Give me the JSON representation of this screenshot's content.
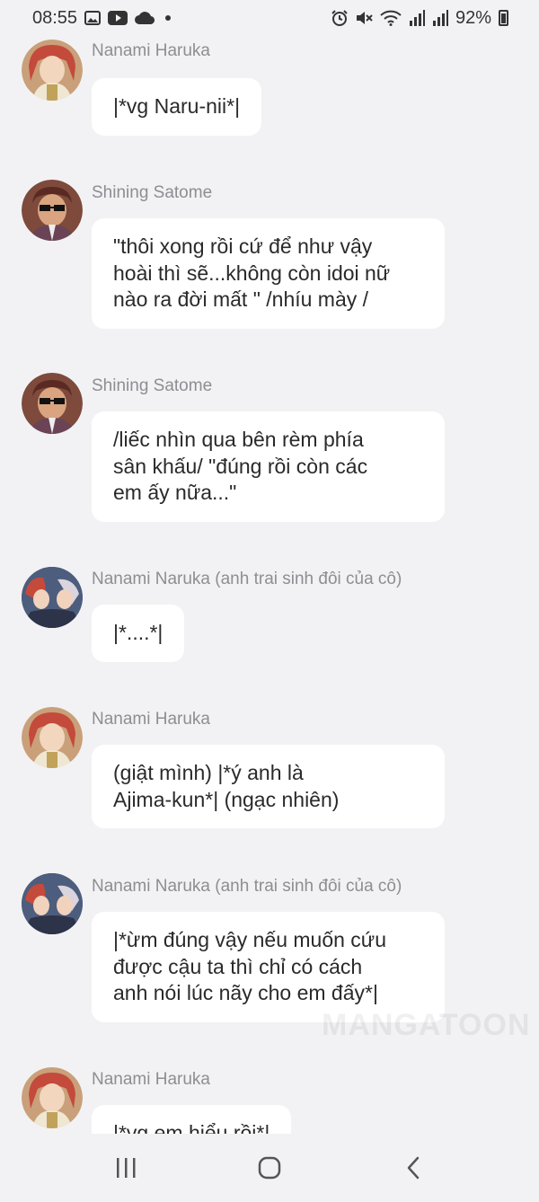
{
  "status_bar": {
    "time": "08:55",
    "battery": "92%",
    "icons": [
      "gallery-icon",
      "youtube-icon",
      "cloud-icon",
      "notification-dot-icon",
      "alarm-icon",
      "mute-icon",
      "wifi-icon",
      "signal-icon",
      "signal-icon",
      "battery-icon"
    ]
  },
  "messages": [
    {
      "sender": "Nanami Haruka",
      "avatar": "haruka",
      "text": "|*vg Naru-nii*|"
    },
    {
      "sender": "Shining Satome",
      "avatar": "satome",
      "text": "\"thôi xong rồi cứ để như vậy\nhoài thì sẽ...không còn idoi nữ\nnào ra đời mất \" /nhíu mày /"
    },
    {
      "sender": "Shining Satome",
      "avatar": "satome",
      "text": "/liếc nhìn qua bên rèm phía\nsân khấu/ \"đúng rồi còn các\nem ấy nữa...\""
    },
    {
      "sender": "Nanami Naruka (anh trai sinh đôi của cô)",
      "avatar": "naruka",
      "text": "|*....*|"
    },
    {
      "sender": "Nanami Haruka",
      "avatar": "haruka",
      "text": "(giật mình) |*ý anh là\nAjima-kun*| (ngạc nhiên)"
    },
    {
      "sender": "Nanami Naruka (anh trai sinh đôi của cô)",
      "avatar": "naruka",
      "text": "|*ừm đúng vậy nếu muốn cứu\nđược cậu ta thì chỉ có cách\nanh nói lúc nãy cho em đấy*|"
    },
    {
      "sender": "Nanami Haruka",
      "avatar": "haruka",
      "text": "|*vg em hiểu rồi*|"
    }
  ],
  "watermark": "MANGATOON",
  "nav": {
    "icons": [
      "recent-apps-icon",
      "home-icon",
      "back-icon"
    ]
  },
  "colors": {
    "background": "#f2f2f4",
    "bubble": "#ffffff",
    "sender": "#8d8d93"
  }
}
